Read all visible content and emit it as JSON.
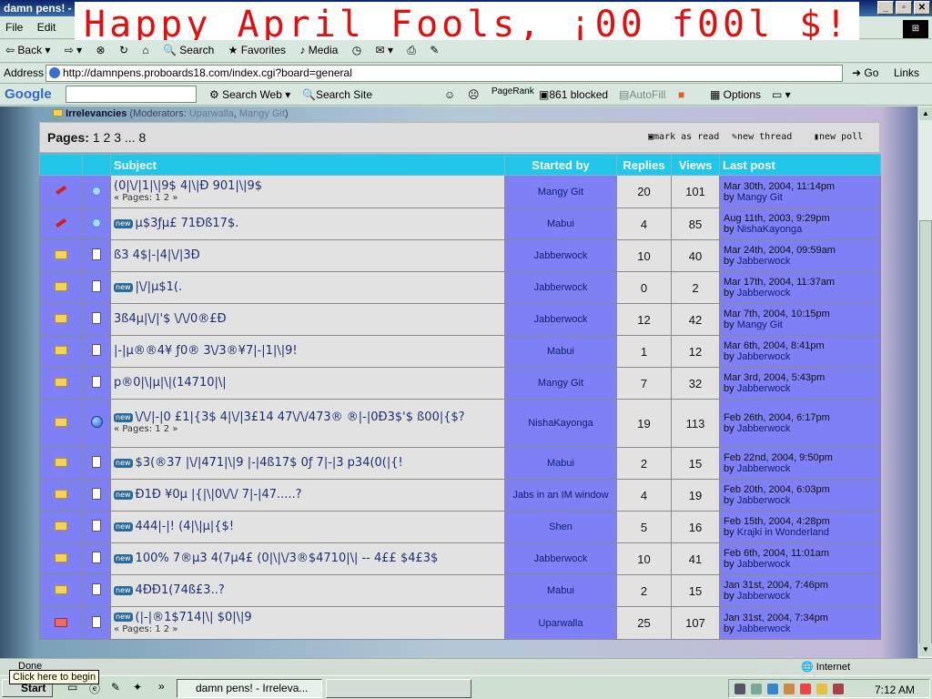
{
  "window": {
    "title": "damn pens! - Irrelevancies - Microsoft Internet Explorer"
  },
  "banner": {
    "text": "Happy April Fools, ¡00 f00l_$!"
  },
  "menu": [
    "File",
    "Edit"
  ],
  "toolbar": {
    "back": "Back",
    "search": "Search",
    "favorites": "Favorites",
    "media": "Media"
  },
  "address": {
    "label": "Address",
    "url": "http://damnpens.proboards18.com/index.cgi?board=general",
    "go": "Go",
    "links": "Links"
  },
  "google": {
    "logo": "Google",
    "search_web": "Search Web",
    "search_site": "Search Site",
    "pagerank": "PageRank",
    "blocked": "861 blocked",
    "autofill": "AutoFill",
    "options": "Options"
  },
  "breadcrumb": {
    "board": "Irrelevancies",
    "mods_prefix": "(Moderators: ",
    "mod1": "Uparwalla",
    "sep": ", ",
    "mod2": "Mangy Git",
    "mods_suffix": ")"
  },
  "pages": {
    "label": "Pages:",
    "current": "1",
    "p2": "2",
    "p3": "3",
    "dots": "...",
    "last": "8"
  },
  "actions": {
    "mark_read": "mark as read",
    "new_thread": "new thread",
    "new_poll": "new poll"
  },
  "headers": {
    "subject": "Subject",
    "started_by": "Started by",
    "replies": "Replies",
    "views": "Views",
    "last_post": "Last post"
  },
  "threads": [
    {
      "subject": "(0|\\/|1|\\|9$ 4|\\|Ð 901|\\|9$",
      "new": false,
      "pages": "« Pages: 1 2 »",
      "started_by": "Mangy Git",
      "replies": "20",
      "views": "101",
      "lp_date": "Mar 30th, 2004, 11:14pm",
      "lp_by": "Mangy Git",
      "icon": "pin",
      "type": "bulb"
    },
    {
      "subject": "µ$3ƒµ£ 71Ðß17$.",
      "new": true,
      "pages": "",
      "started_by": "Mabui",
      "replies": "4",
      "views": "85",
      "lp_date": "Aug 11th, 2003, 9:29pm",
      "lp_by": "NishaKayonga",
      "icon": "pin",
      "type": "bulb"
    },
    {
      "subject": "ß3 4$|-|4|\\/|3Ð",
      "new": false,
      "pages": "",
      "started_by": "Jabberwock",
      "replies": "10",
      "views": "40",
      "lp_date": "Mar 24th, 2004, 09:59am",
      "lp_by": "Jabberwock",
      "icon": "folder",
      "type": "doc"
    },
    {
      "subject": "|\\/|µ$1(.",
      "new": true,
      "pages": "",
      "started_by": "Jabberwock",
      "replies": "0",
      "views": "2",
      "lp_date": "Mar 17th, 2004, 11:37am",
      "lp_by": "Jabberwock",
      "icon": "folder",
      "type": "doc"
    },
    {
      "subject": "3ß4µ|\\/|'$ \\/\\/0®£Ð",
      "new": false,
      "pages": "",
      "started_by": "Jabberwock",
      "replies": "12",
      "views": "42",
      "lp_date": "Mar 7th, 2004, 10:15pm",
      "lp_by": "Mangy Git",
      "icon": "folder",
      "type": "doc"
    },
    {
      "subject": "|-|µ®®4¥ ƒ0® 3\\/3®¥7|-|1|\\|9!",
      "new": false,
      "pages": "",
      "started_by": "Mabui",
      "replies": "1",
      "views": "12",
      "lp_date": "Mar 6th, 2004, 8:41pm",
      "lp_by": "Jabberwock",
      "icon": "folder",
      "type": "doc"
    },
    {
      "subject": "p®0|\\|µ|\\|(14710|\\|",
      "new": false,
      "pages": "",
      "started_by": "Mangy Git",
      "replies": "7",
      "views": "32",
      "lp_date": "Mar 3rd, 2004, 5:43pm",
      "lp_by": "Jabberwock",
      "icon": "folder",
      "type": "doc"
    },
    {
      "subject": "\\/\\/|-|0 £1|{3$ 4|\\/|3£14 47\\/\\/473® ®|-|0Ð3$'$ ß00|{$?",
      "new": true,
      "pages": "« Pages: 1 2 »",
      "started_by": "NishaKayonga",
      "replies": "19",
      "views": "113",
      "lp_date": "Feb 26th, 2004, 6:17pm",
      "lp_by": "Jabberwock",
      "icon": "folder",
      "type": "globe"
    },
    {
      "subject": "$3(®37 |\\/|471|\\|9 |-|4ß17$ 0ƒ 7|-|3 p34(0(|{!",
      "new": true,
      "pages": "",
      "started_by": "Mabui",
      "replies": "2",
      "views": "15",
      "lp_date": "Feb 22nd, 2004, 9:50pm",
      "lp_by": "Jabberwock",
      "icon": "folder",
      "type": "doc"
    },
    {
      "subject": "Ð1Ð ¥0µ |{|\\|0\\/\\/ 7|-|47.....?",
      "new": true,
      "pages": "",
      "started_by": "Jabs in an IM window",
      "replies": "4",
      "views": "19",
      "lp_date": "Feb 20th, 2004, 6:03pm",
      "lp_by": "Jabberwock",
      "icon": "folder",
      "type": "doc"
    },
    {
      "subject": "444|-|! (4|\\|µ|{$!",
      "new": true,
      "pages": "",
      "started_by": "Shen",
      "replies": "5",
      "views": "16",
      "lp_date": "Feb 15th, 2004, 4:28pm",
      "lp_by": "Krajki in Wonderland",
      "icon": "folder",
      "type": "doc"
    },
    {
      "subject": "100% 7®µ3 4(7µ4£ (0|\\|\\/3®$4710|\\| -- 4££ $4£3$",
      "new": true,
      "pages": "",
      "started_by": "Jabberwock",
      "replies": "10",
      "views": "41",
      "lp_date": "Feb 6th, 2004, 11:01am",
      "lp_by": "Jabberwock",
      "icon": "folder",
      "type": "doc"
    },
    {
      "subject": "4ÐÐ1(74ß£3..?",
      "new": true,
      "pages": "",
      "started_by": "Mabui",
      "replies": "2",
      "views": "15",
      "lp_date": "Jan 31st, 2004, 7:46pm",
      "lp_by": "Jabberwock",
      "icon": "folder",
      "type": "doc"
    },
    {
      "subject": "(|-|®1$714|\\| $0|\\|9",
      "new": true,
      "pages": "« Pages: 1 2 »",
      "started_by": "Uparwalla",
      "replies": "25",
      "views": "107",
      "lp_date": "Jan 31st, 2004, 7:34pm",
      "lp_by": "Jabberwock",
      "icon": "hot",
      "type": "doc"
    }
  ],
  "lp_by_prefix": "by ",
  "new_label": "new",
  "status": {
    "done": "Done",
    "zone": "Internet"
  },
  "tooltip": "Click here to begin",
  "taskbar": {
    "start": "Start",
    "task": "damn pens! - Irreleva...",
    "clock": "7:12 AM"
  }
}
